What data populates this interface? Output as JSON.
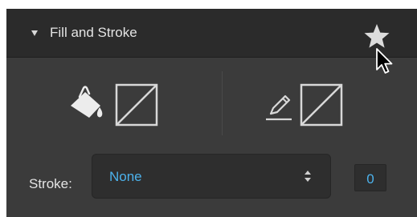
{
  "section": {
    "title": "Fill and Stroke",
    "expanded": true
  },
  "icons": {
    "disclosure": "disclosure-triangle-down-icon",
    "favorite": "star-icon",
    "cursor": "mouse-pointer-icon",
    "fill": "paint-bucket-icon",
    "fill_swatch": "no-color-swatch-icon",
    "stroke": "pen-icon",
    "stroke_swatch": "no-color-swatch-icon",
    "select_arrows": "up-down-arrows-icon"
  },
  "stroke": {
    "label": "Stroke:",
    "type_value": "None",
    "width_value": "0"
  },
  "colors": {
    "panel_bg": "#3b3b3b",
    "header_bg": "#2b2b2b",
    "text": "#e4e4e4",
    "accent": "#4cb2ec",
    "icon": "#d8d8d8"
  }
}
